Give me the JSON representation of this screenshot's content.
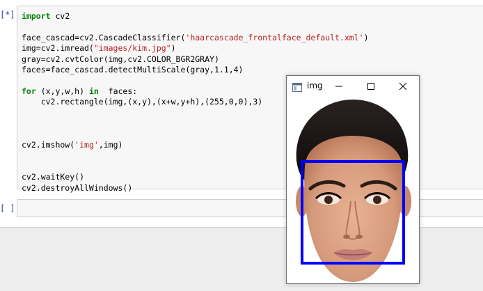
{
  "cells": [
    {
      "prompt": "[*]:",
      "code_lines": {
        "l1": "import cv2",
        "l3a": "face_cascad=cv2.CascadeClassifier(",
        "l3s": "'haarcascade_frontalface_default.xml'",
        "l3b": ")",
        "l4a": "img=cv2.imread(",
        "l4s": "\"images/kim.jpg\"",
        "l4b": ")",
        "l5": "gray=cv2.cvtColor(img,cv2.COLOR_BGR2GRAY)",
        "l6": "faces=face_cascad.detectMultiScale(gray,1.1,4)",
        "l8a": "for",
        "l8b": " (x,y,w,h) ",
        "l8c": "in",
        "l8d": "  faces:",
        "l9": "    cv2.rectangle(img,(x,y),(x+w,y+h),(255,0,0),3)",
        "l13a": "cv2.imshow(",
        "l13s": "'img'",
        "l13b": ",img)",
        "l16": "cv2.waitKey()",
        "l17": "cv2.destroyAllWindows()"
      }
    },
    {
      "prompt": "[ ]:"
    }
  ],
  "window": {
    "title": "img",
    "icon": "window-app-icon",
    "detection_box_color": "#0000ff"
  },
  "colors": {
    "keyword": "#008000",
    "string": "#ba2121",
    "prompt": "#303f9f"
  }
}
